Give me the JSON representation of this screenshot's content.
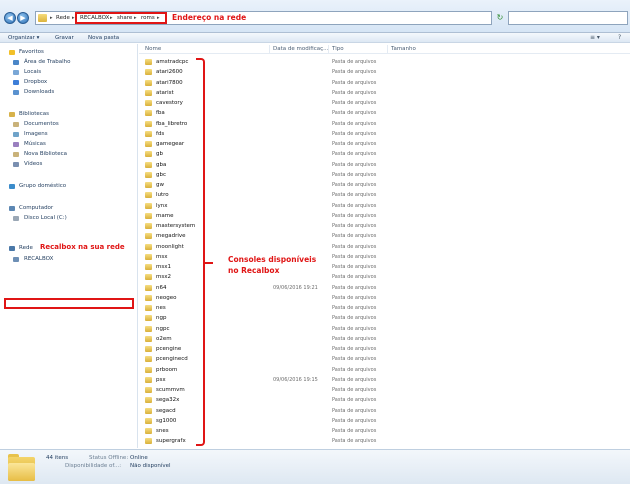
{
  "address": {
    "crumbs": [
      "Rede",
      "RECALBOX",
      "share",
      "roms"
    ],
    "annotation": "Endereço na rede",
    "dropdown": "▾",
    "refresh": "↻",
    "back": "◀",
    "forward": "▶"
  },
  "toolbar": {
    "organize": "Organizar ▾",
    "burn": "Gravar",
    "new_folder": "Nova pasta",
    "view": "≡ ▾",
    "help": "?"
  },
  "nav": {
    "favorites": "Favoritos",
    "desktop": "Área de Trabalho",
    "places": "Locais",
    "dropbox": "Dropbox",
    "downloads": "Downloads",
    "libraries": "Bibliotecas",
    "documents": "Documentos",
    "images": "Imagens",
    "music": "Músicas",
    "new_library": "Nova Biblioteca",
    "videos": "Vídeos",
    "homegroup": "Grupo doméstico",
    "computer": "Computador",
    "local_disk": "Disco Local (C:)",
    "network": "Rede",
    "recalbox": "RECALBOX",
    "network_annotation": "Recalbox na sua rede"
  },
  "columns": {
    "name": "Nome",
    "date": "Data de modificaç...",
    "type": "Tipo",
    "size": "Tamanho"
  },
  "files": [
    {
      "name": "amstradcpc",
      "date": "",
      "type": "Pasta de arquivos"
    },
    {
      "name": "atari2600",
      "date": "",
      "type": "Pasta de arquivos"
    },
    {
      "name": "atari7800",
      "date": "",
      "type": "Pasta de arquivos"
    },
    {
      "name": "atarist",
      "date": "",
      "type": "Pasta de arquivos"
    },
    {
      "name": "cavestory",
      "date": "",
      "type": "Pasta de arquivos"
    },
    {
      "name": "fba",
      "date": "",
      "type": "Pasta de arquivos"
    },
    {
      "name": "fba_libretro",
      "date": "",
      "type": "Pasta de arquivos"
    },
    {
      "name": "fds",
      "date": "",
      "type": "Pasta de arquivos"
    },
    {
      "name": "gamegear",
      "date": "",
      "type": "Pasta de arquivos"
    },
    {
      "name": "gb",
      "date": "",
      "type": "Pasta de arquivos"
    },
    {
      "name": "gba",
      "date": "",
      "type": "Pasta de arquivos"
    },
    {
      "name": "gbc",
      "date": "",
      "type": "Pasta de arquivos"
    },
    {
      "name": "gw",
      "date": "",
      "type": "Pasta de arquivos"
    },
    {
      "name": "lutro",
      "date": "",
      "type": "Pasta de arquivos"
    },
    {
      "name": "lynx",
      "date": "",
      "type": "Pasta de arquivos"
    },
    {
      "name": "mame",
      "date": "",
      "type": "Pasta de arquivos"
    },
    {
      "name": "mastersystem",
      "date": "",
      "type": "Pasta de arquivos"
    },
    {
      "name": "megadrive",
      "date": "",
      "type": "Pasta de arquivos"
    },
    {
      "name": "moonlight",
      "date": "",
      "type": "Pasta de arquivos"
    },
    {
      "name": "msx",
      "date": "",
      "type": "Pasta de arquivos"
    },
    {
      "name": "msx1",
      "date": "",
      "type": "Pasta de arquivos"
    },
    {
      "name": "msx2",
      "date": "",
      "type": "Pasta de arquivos"
    },
    {
      "name": "n64",
      "date": "09/06/2016 19:21",
      "type": "Pasta de arquivos"
    },
    {
      "name": "neogeo",
      "date": "",
      "type": "Pasta de arquivos"
    },
    {
      "name": "nes",
      "date": "",
      "type": "Pasta de arquivos"
    },
    {
      "name": "ngp",
      "date": "",
      "type": "Pasta de arquivos"
    },
    {
      "name": "ngpc",
      "date": "",
      "type": "Pasta de arquivos"
    },
    {
      "name": "o2em",
      "date": "",
      "type": "Pasta de arquivos"
    },
    {
      "name": "pcengine",
      "date": "",
      "type": "Pasta de arquivos"
    },
    {
      "name": "pcenginecd",
      "date": "",
      "type": "Pasta de arquivos"
    },
    {
      "name": "prboom",
      "date": "",
      "type": "Pasta de arquivos"
    },
    {
      "name": "psx",
      "date": "09/06/2016 19:15",
      "type": "Pasta de arquivos"
    },
    {
      "name": "scummvm",
      "date": "",
      "type": "Pasta de arquivos"
    },
    {
      "name": "sega32x",
      "date": "",
      "type": "Pasta de arquivos"
    },
    {
      "name": "segacd",
      "date": "",
      "type": "Pasta de arquivos"
    },
    {
      "name": "sg1000",
      "date": "",
      "type": "Pasta de arquivos"
    },
    {
      "name": "snes",
      "date": "",
      "type": "Pasta de arquivos"
    },
    {
      "name": "supergrafx",
      "date": "",
      "type": "Pasta de arquivos"
    }
  ],
  "consoles_annotation": [
    "Consoles disponíveis",
    "no Recalbox"
  ],
  "details": {
    "count": "44 itens",
    "status_label": "Status Offline:",
    "status_value": "Online",
    "avail_label": "Disponibilidade of...:",
    "avail_value": "Não disponível"
  },
  "colors": {
    "annotation": "#e01515",
    "folder": "#e7bd45"
  }
}
